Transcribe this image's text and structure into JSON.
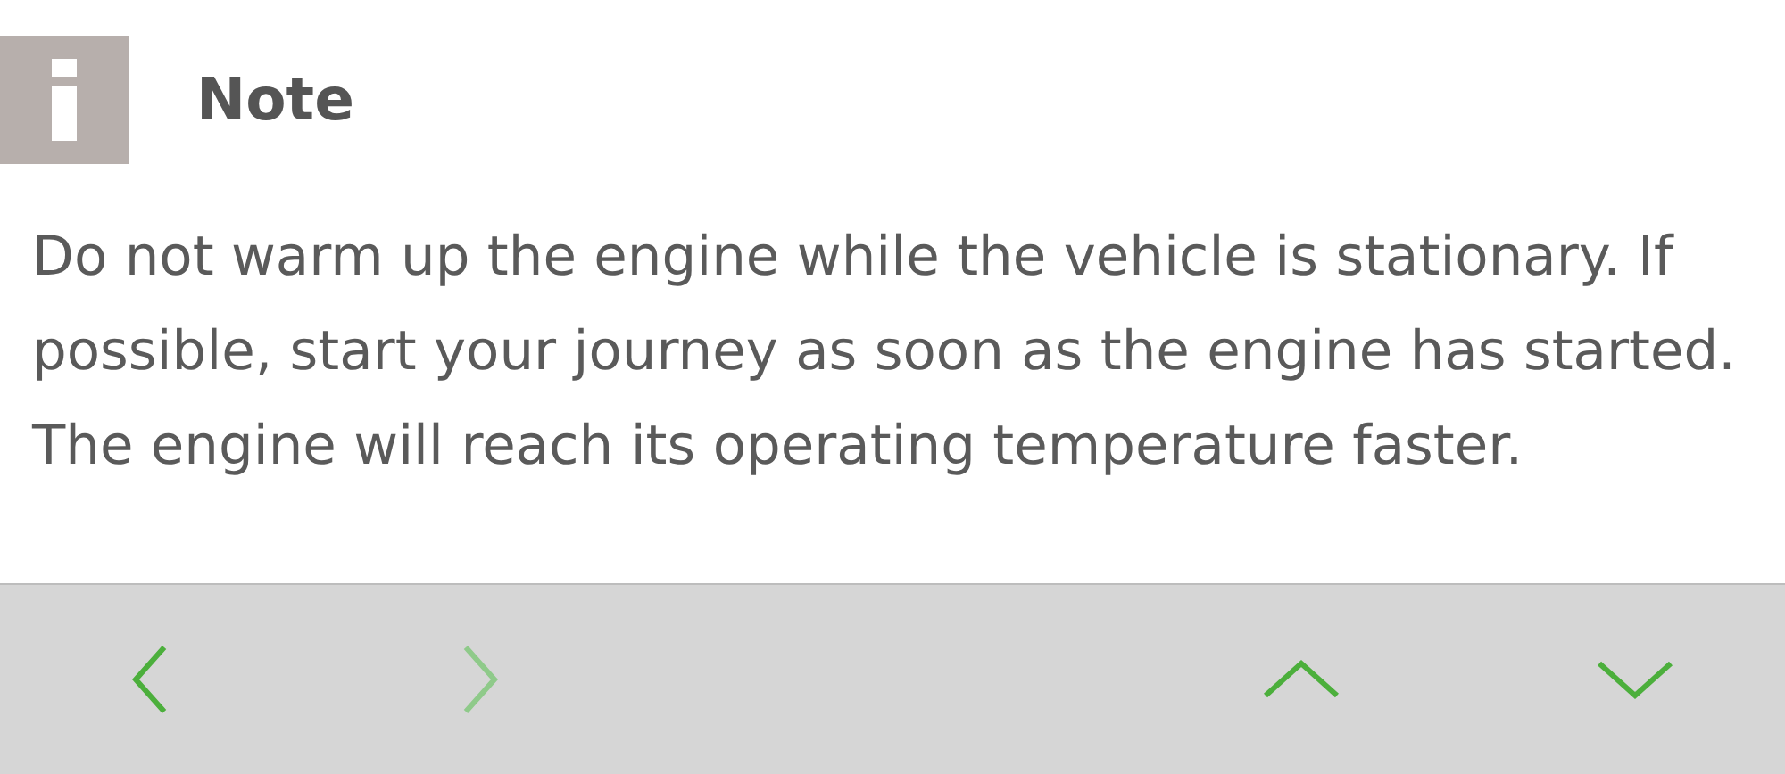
{
  "note": {
    "title": "Note",
    "text": "Do not warm up the engine while the vehicle is stationary. If possible, start your journey as soon as the engine has started. The engine will reach its operating temperature faster."
  },
  "toolbar": [
    {
      "kind": "left",
      "disabled": false
    },
    {
      "kind": "right",
      "disabled": true
    },
    {
      "kind": "up",
      "disabled": false
    },
    {
      "kind": "down",
      "disabled": false
    }
  ]
}
